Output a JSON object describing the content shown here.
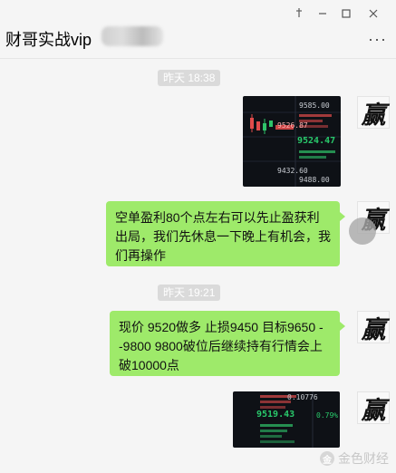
{
  "window": {
    "title": "财哥实战vip",
    "minimize_icon": "minimize-icon",
    "maximize_icon": "maximize-icon",
    "close_icon": "close-icon",
    "pin_icon": "pin-icon",
    "more_icon": "more-icon"
  },
  "messages": [
    {
      "type": "time",
      "text": "昨天 18:38"
    },
    {
      "type": "image",
      "sender_avatar": "赢",
      "content": {
        "top_label": "9585.00",
        "mid_label": "9524.47",
        "side_price": "9526.87",
        "bottom_label": "9432.60",
        "low_label": "9488.00"
      }
    },
    {
      "type": "text",
      "sender_avatar": "赢",
      "text": "空单盈利80个点左右可以先止盈获利出局，我们先休息一下晚上有机会，我们再操作"
    },
    {
      "type": "time",
      "text": "昨天 19:21"
    },
    {
      "type": "text",
      "sender_avatar": "赢",
      "text": "现价 9520做多 止损9450  目标9650 - -9800  9800破位后继续持有行情会上破10000点"
    },
    {
      "type": "image",
      "sender_avatar": "赢",
      "content": {
        "price": "9519.43",
        "pct": "0.79%",
        "top_label": "9519.43",
        "sub_label": "0.10776"
      }
    }
  ],
  "watermark": {
    "icon_text": "金",
    "text": "金色财经"
  },
  "colors": {
    "bubble": "#9eea6a",
    "chat_bg": "#f5f5f5",
    "time_chip": "#dadada",
    "chart_bg": "#0e1116"
  }
}
